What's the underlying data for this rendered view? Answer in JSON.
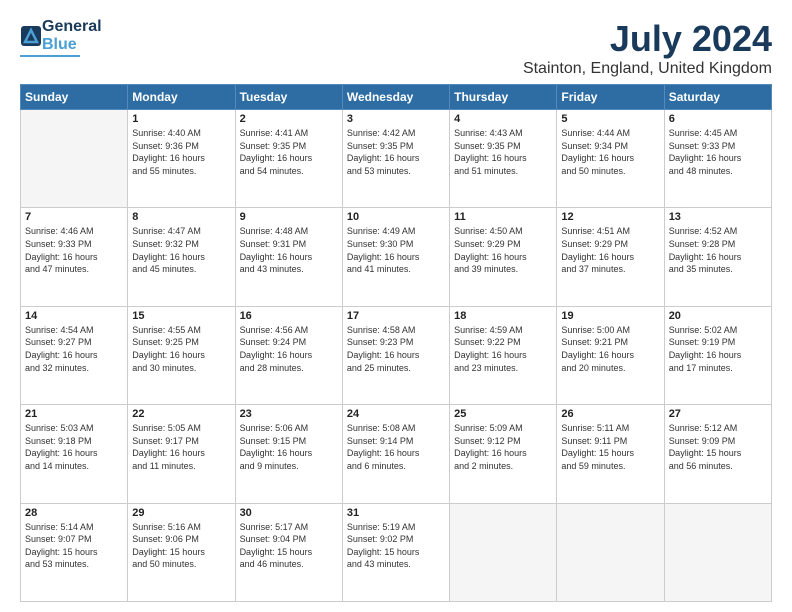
{
  "header": {
    "logo": {
      "line1": "General",
      "line2": "Blue"
    },
    "title": "July 2024",
    "subtitle": "Stainton, England, United Kingdom"
  },
  "weekdays": [
    "Sunday",
    "Monday",
    "Tuesday",
    "Wednesday",
    "Thursday",
    "Friday",
    "Saturday"
  ],
  "weeks": [
    [
      {
        "day": "",
        "info": ""
      },
      {
        "day": "1",
        "info": "Sunrise: 4:40 AM\nSunset: 9:36 PM\nDaylight: 16 hours\nand 55 minutes."
      },
      {
        "day": "2",
        "info": "Sunrise: 4:41 AM\nSunset: 9:35 PM\nDaylight: 16 hours\nand 54 minutes."
      },
      {
        "day": "3",
        "info": "Sunrise: 4:42 AM\nSunset: 9:35 PM\nDaylight: 16 hours\nand 53 minutes."
      },
      {
        "day": "4",
        "info": "Sunrise: 4:43 AM\nSunset: 9:35 PM\nDaylight: 16 hours\nand 51 minutes."
      },
      {
        "day": "5",
        "info": "Sunrise: 4:44 AM\nSunset: 9:34 PM\nDaylight: 16 hours\nand 50 minutes."
      },
      {
        "day": "6",
        "info": "Sunrise: 4:45 AM\nSunset: 9:33 PM\nDaylight: 16 hours\nand 48 minutes."
      }
    ],
    [
      {
        "day": "7",
        "info": "Sunrise: 4:46 AM\nSunset: 9:33 PM\nDaylight: 16 hours\nand 47 minutes."
      },
      {
        "day": "8",
        "info": "Sunrise: 4:47 AM\nSunset: 9:32 PM\nDaylight: 16 hours\nand 45 minutes."
      },
      {
        "day": "9",
        "info": "Sunrise: 4:48 AM\nSunset: 9:31 PM\nDaylight: 16 hours\nand 43 minutes."
      },
      {
        "day": "10",
        "info": "Sunrise: 4:49 AM\nSunset: 9:30 PM\nDaylight: 16 hours\nand 41 minutes."
      },
      {
        "day": "11",
        "info": "Sunrise: 4:50 AM\nSunset: 9:29 PM\nDaylight: 16 hours\nand 39 minutes."
      },
      {
        "day": "12",
        "info": "Sunrise: 4:51 AM\nSunset: 9:29 PM\nDaylight: 16 hours\nand 37 minutes."
      },
      {
        "day": "13",
        "info": "Sunrise: 4:52 AM\nSunset: 9:28 PM\nDaylight: 16 hours\nand 35 minutes."
      }
    ],
    [
      {
        "day": "14",
        "info": "Sunrise: 4:54 AM\nSunset: 9:27 PM\nDaylight: 16 hours\nand 32 minutes."
      },
      {
        "day": "15",
        "info": "Sunrise: 4:55 AM\nSunset: 9:25 PM\nDaylight: 16 hours\nand 30 minutes."
      },
      {
        "day": "16",
        "info": "Sunrise: 4:56 AM\nSunset: 9:24 PM\nDaylight: 16 hours\nand 28 minutes."
      },
      {
        "day": "17",
        "info": "Sunrise: 4:58 AM\nSunset: 9:23 PM\nDaylight: 16 hours\nand 25 minutes."
      },
      {
        "day": "18",
        "info": "Sunrise: 4:59 AM\nSunset: 9:22 PM\nDaylight: 16 hours\nand 23 minutes."
      },
      {
        "day": "19",
        "info": "Sunrise: 5:00 AM\nSunset: 9:21 PM\nDaylight: 16 hours\nand 20 minutes."
      },
      {
        "day": "20",
        "info": "Sunrise: 5:02 AM\nSunset: 9:19 PM\nDaylight: 16 hours\nand 17 minutes."
      }
    ],
    [
      {
        "day": "21",
        "info": "Sunrise: 5:03 AM\nSunset: 9:18 PM\nDaylight: 16 hours\nand 14 minutes."
      },
      {
        "day": "22",
        "info": "Sunrise: 5:05 AM\nSunset: 9:17 PM\nDaylight: 16 hours\nand 11 minutes."
      },
      {
        "day": "23",
        "info": "Sunrise: 5:06 AM\nSunset: 9:15 PM\nDaylight: 16 hours\nand 9 minutes."
      },
      {
        "day": "24",
        "info": "Sunrise: 5:08 AM\nSunset: 9:14 PM\nDaylight: 16 hours\nand 6 minutes."
      },
      {
        "day": "25",
        "info": "Sunrise: 5:09 AM\nSunset: 9:12 PM\nDaylight: 16 hours\nand 2 minutes."
      },
      {
        "day": "26",
        "info": "Sunrise: 5:11 AM\nSunset: 9:11 PM\nDaylight: 15 hours\nand 59 minutes."
      },
      {
        "day": "27",
        "info": "Sunrise: 5:12 AM\nSunset: 9:09 PM\nDaylight: 15 hours\nand 56 minutes."
      }
    ],
    [
      {
        "day": "28",
        "info": "Sunrise: 5:14 AM\nSunset: 9:07 PM\nDaylight: 15 hours\nand 53 minutes."
      },
      {
        "day": "29",
        "info": "Sunrise: 5:16 AM\nSunset: 9:06 PM\nDaylight: 15 hours\nand 50 minutes."
      },
      {
        "day": "30",
        "info": "Sunrise: 5:17 AM\nSunset: 9:04 PM\nDaylight: 15 hours\nand 46 minutes."
      },
      {
        "day": "31",
        "info": "Sunrise: 5:19 AM\nSunset: 9:02 PM\nDaylight: 15 hours\nand 43 minutes."
      },
      {
        "day": "",
        "info": ""
      },
      {
        "day": "",
        "info": ""
      },
      {
        "day": "",
        "info": ""
      }
    ]
  ]
}
